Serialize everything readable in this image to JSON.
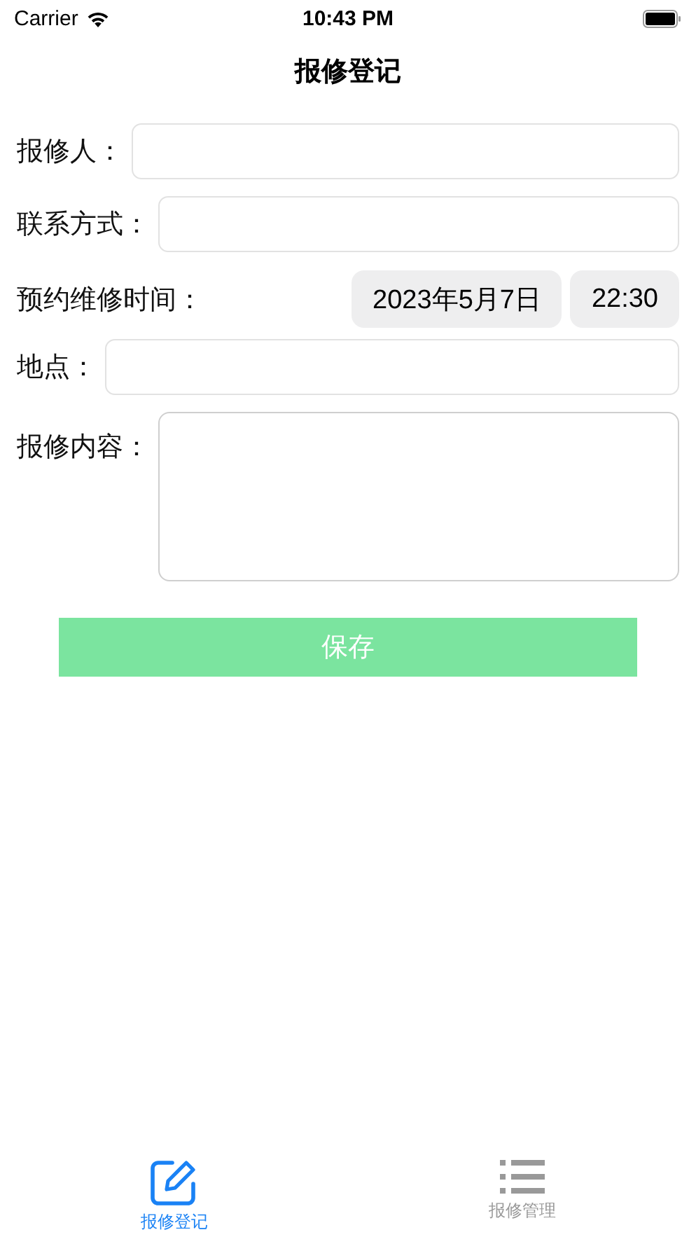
{
  "status_bar": {
    "carrier": "Carrier",
    "time": "10:43 PM"
  },
  "nav": {
    "title": "报修登记"
  },
  "fields": [
    {
      "kind": "input",
      "label": "报修人："
    },
    {
      "kind": "input",
      "label": "联系方式："
    },
    {
      "kind": "datetime",
      "label": "预约维修时间：",
      "date": "2023年5月7日",
      "time": "22:30"
    },
    {
      "kind": "input",
      "label": "地点："
    },
    {
      "kind": "textarea",
      "label": "报修内容："
    }
  ],
  "save_button": {
    "label": "保存",
    "disabled": true
  },
  "tabs": [
    {
      "kind": "edit",
      "label": "报修登记",
      "selected": true
    },
    {
      "kind": "list",
      "label": "报修管理",
      "selected": false
    }
  ]
}
